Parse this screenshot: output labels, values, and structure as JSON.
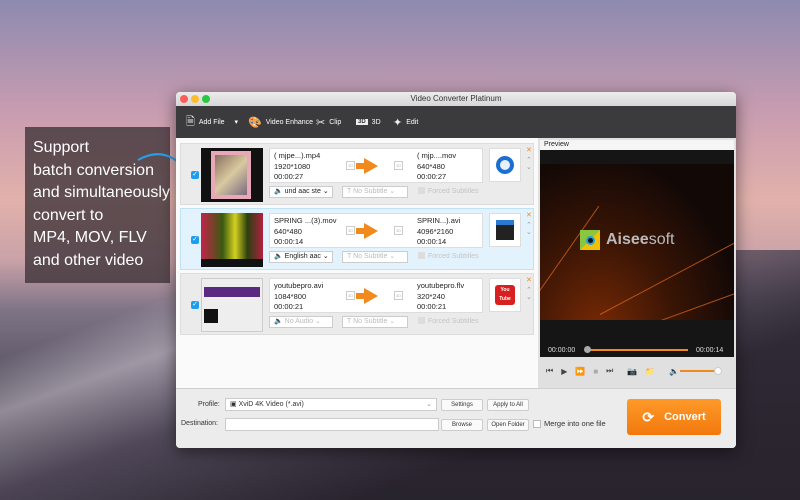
{
  "callout": {
    "lines": [
      "Support",
      "batch conversion",
      "and simultaneously",
      "convert to",
      "MP4, MOV, FLV",
      "and other video"
    ]
  },
  "window": {
    "title": "Video Converter Platinum"
  },
  "toolbar": {
    "add_file": "Add File",
    "video_enhance": "Video Enhance",
    "clip": "Clip",
    "three_d": "3D",
    "edit": "Edit"
  },
  "files": [
    {
      "src_name": "( mjpe...).mp4",
      "src_res": "1920*1080",
      "src_dur": "00:00:27",
      "dst_name": "( mjp....mov",
      "dst_res": "640*480",
      "dst_dur": "00:00:27",
      "audio": "und aac ste",
      "subtitle": "No Subtitle",
      "forced": "Forced Subtitles",
      "format_icon": "quicktime-icon"
    },
    {
      "src_name": "SPRING ...(3).mov",
      "src_res": "640*480",
      "src_dur": "00:00:14",
      "dst_name": "SPRIN...).avi",
      "dst_res": "4096*2160",
      "dst_dur": "00:00:14",
      "audio": "English aac",
      "subtitle": "No Subtitle",
      "forced": "Forced Subtitles",
      "format_icon": "4k-video-icon"
    },
    {
      "src_name": "youtubepro.avi",
      "src_res": "1084*800",
      "src_dur": "00:00:21",
      "dst_name": "youtubepro.flv",
      "dst_res": "320*240",
      "dst_dur": "00:00:21",
      "audio": "No Audio",
      "subtitle": "No Subtitle",
      "forced": "Forced Subtitles",
      "format_icon": "youtube-icon",
      "youtube_text": "You Tube"
    }
  ],
  "d3_label": "3D",
  "preview": {
    "title": "Preview",
    "logo_a": "Aisee",
    "logo_b": "soft",
    "time_current": "00:00:00",
    "time_total": "00:00:14",
    "progress": 0,
    "volume": 0.85
  },
  "bottom": {
    "profile_label": "Profile:",
    "profile_value": "XviD 4K Video (*.avi)",
    "settings": "Settings",
    "apply_all": "Apply to All",
    "destination_label": "Destination:",
    "destination_value": "",
    "browse": "Browse",
    "open_folder": "Open Folder",
    "merge": "Merge into one file",
    "convert": "Convert"
  }
}
